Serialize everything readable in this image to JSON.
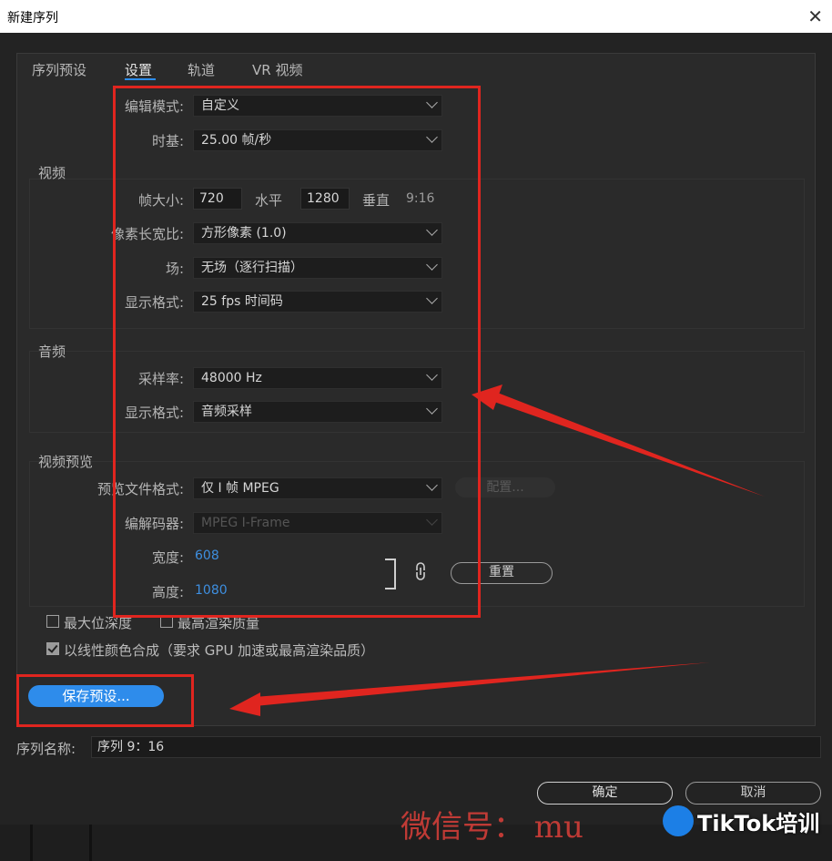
{
  "window": {
    "title": "新建序列"
  },
  "tabs": [
    "序列预设",
    "设置",
    "轨道",
    "VR 视频"
  ],
  "edit_mode": {
    "label": "编辑模式:",
    "value": "自定义"
  },
  "timebase": {
    "label": "时基:",
    "value": "25.00  帧/秒"
  },
  "video": {
    "title": "视频",
    "frame_size_label": "帧大小:",
    "width": "720",
    "horizontal_label": "水平",
    "height": "1280",
    "vertical_label": "垂直",
    "aspect": "9:16",
    "pixel_aspect_label": "像素长宽比:",
    "pixel_aspect_value": "方形像素 (1.0)",
    "field_label": "场:",
    "field_value": "无场（逐行扫描）",
    "display_format_label": "显示格式:",
    "display_format_value": "25 fps 时间码"
  },
  "audio": {
    "title": "音频",
    "sample_rate_label": "采样率:",
    "sample_rate_value": "48000 Hz",
    "display_format_label": "显示格式:",
    "display_format_value": "音频采样"
  },
  "preview": {
    "title": "视频预览",
    "file_format_label": "预览文件格式:",
    "file_format_value": "仅 I 帧 MPEG",
    "config_button": "配置...",
    "codec_label": "编解码器:",
    "codec_value": "MPEG I-Frame",
    "width_label": "宽度:",
    "width_value": "608",
    "height_label": "高度:",
    "height_value": "1080",
    "reset_button": "重置"
  },
  "options": {
    "max_bit_depth": "最大位深度",
    "max_render_quality": "最高渲染质量",
    "linear_color": "以线性颜色合成（要求 GPU 加速或最高渲染品质）"
  },
  "save_preset_button": "保存预设...",
  "sequence_name": {
    "label": "序列名称:",
    "value": "序列 9：16"
  },
  "buttons": {
    "ok": "确定",
    "cancel": "取消"
  },
  "watermark": "微信号：  mu",
  "logo": "TikTok培训",
  "colors": {
    "accent": "#2e8ceb",
    "annotation": "#e0251f",
    "background": "#232323"
  }
}
